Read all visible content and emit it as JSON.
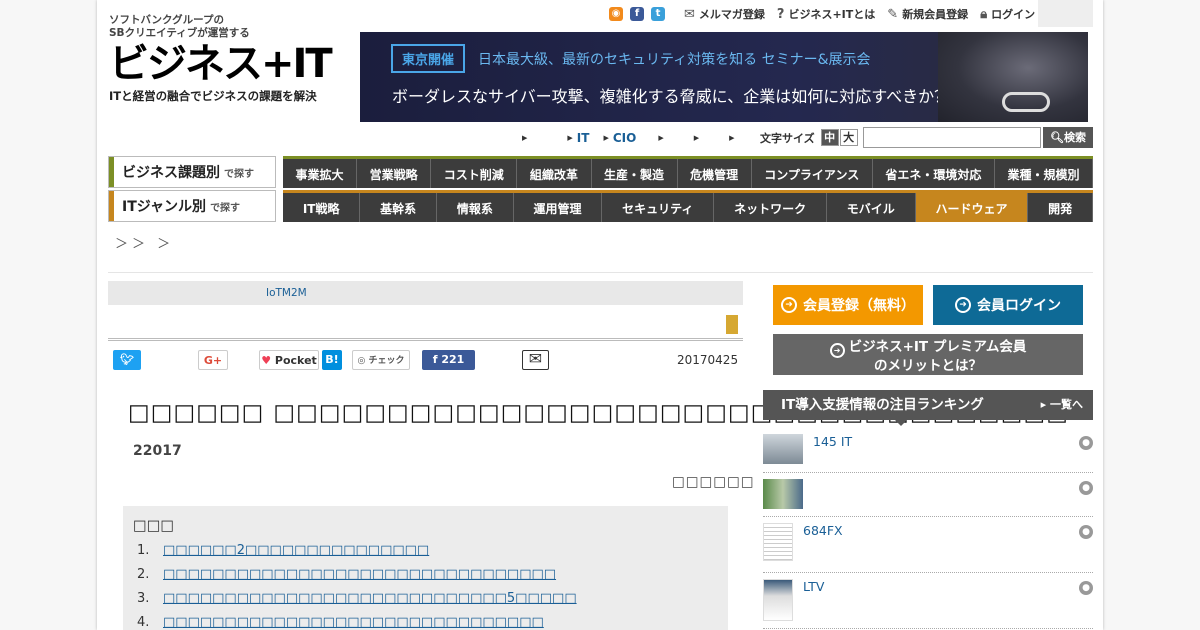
{
  "header": {
    "logo_line1": "ソフトバンクグループの",
    "logo_line2": "SBクリエイティブが運営する",
    "logo_main": "ビジネス+IT",
    "logo_tagline": "ITと経営の融合でビジネスの課題を解決",
    "links": {
      "mailmag": "メルマガ登録",
      "about": "ビジネス+ITとは",
      "register": "新規会員登録",
      "login": "ログイン"
    }
  },
  "banner": {
    "badge": "東京開催",
    "subtitle": "日本最大級、最新のセキュリティ対策を知る セミナー&展示会",
    "headline": "ボーダレスなサイバー攻撃、複雑化する脅威に、企業は如何に対応すべきか？"
  },
  "subnav": {
    "items": [
      "",
      "IT",
      "CIO",
      "",
      "",
      ""
    ]
  },
  "textsize": {
    "label": "文字サイズ",
    "mid": "中",
    "large": "大"
  },
  "search": {
    "placeholder": "",
    "button": "検索"
  },
  "category_nav": {
    "label": "ビジネス課題別",
    "label_suffix": "で探す",
    "items": [
      "事業拡大",
      "営業戦略",
      "コスト削減",
      "組織改革",
      "生産・製造",
      "危機管理",
      "コンプライアンス",
      "省エネ・環境対応",
      "業種・規模別"
    ]
  },
  "genre_nav": {
    "label": "ITジャンル別",
    "label_suffix": "で探す",
    "items": [
      "IT戦略",
      "基幹系",
      "情報系",
      "運用管理",
      "セキュリティ",
      "ネットワーク",
      "モバイル",
      "ハードウェア",
      "開発"
    ],
    "active_index": 7
  },
  "breadcrumb": "＞＞ ＞",
  "article": {
    "tag": "IoTM2M",
    "date": "20170425",
    "share": {
      "twitter": "",
      "gplus": "G+",
      "pocket": "Pocket",
      "hatena": "B!",
      "check": "チェック",
      "facebook_count": "221"
    },
    "title": "□□□□□□ □□□□□□□□□□□□□□□□□□□□□□□□□□□□□□□□□□□",
    "subtitle": "22017",
    "author": "□□□□□□",
    "toc": {
      "heading": "□□□",
      "items": [
        {
          "num": "1.",
          "text": "□□□□□□2□□□□□□□□□□□□□□□"
        },
        {
          "num": "2.",
          "text": "□□□□□□□□□□□□□□□□□□□□□□□□□□□□□□□□"
        },
        {
          "num": "3.",
          "text": "□□□□□□□□□□□□□□□□□□□□□□□□□□□□5□□□□□"
        },
        {
          "num": "4.",
          "text": "□□□□□□□□□□□□□□□□□□□□□□□□□□□□□□□"
        }
      ]
    }
  },
  "sidebar": {
    "register_button": "会員登録（無料）",
    "login_button": "会員ログイン",
    "premium_line1": "ビジネス+IT プレミアム会員",
    "premium_line2": "のメリットとは？",
    "ranking_title": "IT導入支援情報の注目ランキング",
    "ranking_more": "一覧へ",
    "ranking": [
      {
        "text": "145 IT"
      },
      {
        "text": ""
      },
      {
        "text": "684FX"
      },
      {
        "text": "LTV"
      }
    ]
  },
  "colors": {
    "accent_orange": "#f39800",
    "login_blue": "#0e6a96",
    "nav_dark": "#3c3c3c",
    "nav_active": "#c6861e",
    "link_blue": "#1a5f96"
  }
}
